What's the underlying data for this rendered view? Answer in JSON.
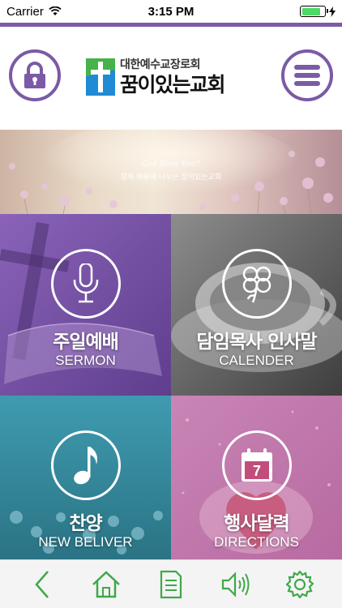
{
  "status_bar": {
    "carrier": "Carrier",
    "time": "3:15 PM",
    "battery_level": 0.85,
    "battery_color": "#4cd964"
  },
  "header": {
    "left_button_icon": "lock-icon",
    "right_button_icon": "menu-icon",
    "accent_color": "#7b5aa6",
    "logo": {
      "subtitle": "대한예수교장로회",
      "name": "꿈이있는교회"
    }
  },
  "banner": {
    "line1": "God Bless You!!",
    "line2": "함께 배울며 나누는 꿈이있는교회"
  },
  "tiles": [
    {
      "title_ko": "주일예배",
      "title_en": "SERMON",
      "icon": "microphone-icon"
    },
    {
      "title_ko": "담임목사 인사말",
      "title_en": "CALENDER",
      "icon": "clover-icon"
    },
    {
      "title_ko": "찬양",
      "title_en": "NEW BELIVER",
      "icon": "music-note-icon"
    },
    {
      "title_ko": "행사달력",
      "title_en": "DIRECTIONS",
      "icon": "calendar-icon",
      "calendar_day": "7"
    }
  ],
  "toolbar": {
    "color": "#3fa84a",
    "items": [
      "back-icon",
      "home-icon",
      "document-icon",
      "speaker-icon",
      "gear-icon"
    ]
  }
}
